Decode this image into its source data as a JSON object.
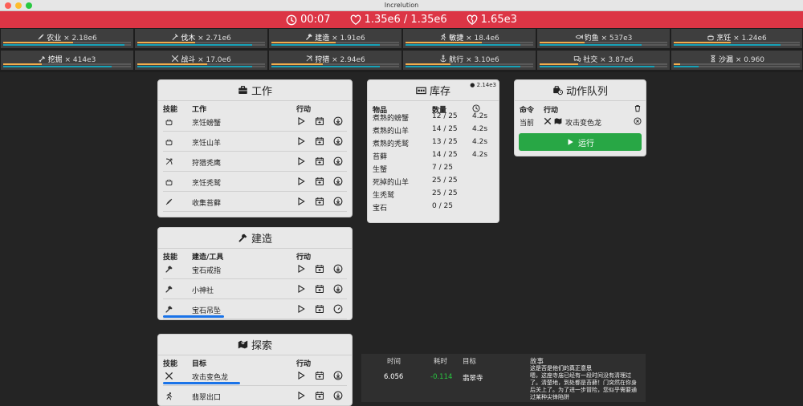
{
  "window": {
    "title": "Increlution"
  },
  "status": {
    "time": "00:07",
    "health": "1.35e6 / 1.35e6",
    "lifespan": "1.65e3"
  },
  "skills": [
    {
      "label": "农业",
      "mult": "× 2.18e6",
      "icon": "wheat-icon",
      "p1": 0.55,
      "p2": 0.95
    },
    {
      "label": "伐木",
      "mult": "× 2.71e6",
      "icon": "axe-icon",
      "p1": 0.45,
      "p2": 0.9
    },
    {
      "label": "建造",
      "mult": "× 1.91e6",
      "icon": "hammer-icon",
      "p1": 0.5,
      "p2": 0.85
    },
    {
      "label": "敏捷",
      "mult": "× 18.4e6",
      "icon": "runner-icon",
      "p1": 0.6,
      "p2": 0.9
    },
    {
      "label": "钓鱼",
      "mult": "× 537e3",
      "icon": "fish-icon",
      "p1": 0.35,
      "p2": 0.8
    },
    {
      "label": "烹饪",
      "mult": "× 1.24e6",
      "icon": "cooking-pot-icon",
      "p1": 0.45,
      "p2": 0.85
    },
    {
      "label": "挖掘",
      "mult": "× 414e3",
      "icon": "shovel-icon",
      "p1": 0.3,
      "p2": 0.85
    },
    {
      "label": "战斗",
      "mult": "× 17.0e6",
      "icon": "crossed-swords-icon",
      "p1": 0.55,
      "p2": 0.9
    },
    {
      "label": "狩猎",
      "mult": "× 2.94e6",
      "icon": "bow-icon",
      "p1": 0.4,
      "p2": 0.85
    },
    {
      "label": "航行",
      "mult": "× 3.10e6",
      "icon": "anchor-icon",
      "p1": 0.35,
      "p2": 0.9
    },
    {
      "label": "社交",
      "mult": "× 3.87e6",
      "icon": "chat-icon",
      "p1": 0.3,
      "p2": 0.9
    },
    {
      "label": "沙漏",
      "mult": "× 0.960",
      "icon": "hourglass-icon",
      "p1": 0.05,
      "p2": 0.2
    }
  ],
  "work": {
    "title": "工作",
    "col_skill": "技能",
    "col_name": "工作",
    "col_act": "行动",
    "rows": [
      {
        "name": "烹饪螃蟹",
        "icon": "cooking-pot-icon"
      },
      {
        "name": "烹饪山羊",
        "icon": "cooking-pot-icon"
      },
      {
        "name": "狩猎秃鹰",
        "icon": "bow-icon"
      },
      {
        "name": "烹饪秃鹫",
        "icon": "cooking-pot-icon"
      },
      {
        "name": "收集苔藓",
        "icon": "wheat-icon"
      }
    ]
  },
  "build": {
    "title": "建造",
    "col_skill": "技能",
    "col_name": "建造/工具",
    "col_act": "行动",
    "rows": [
      {
        "name": "宝石戒指",
        "icon": "hammer-icon"
      },
      {
        "name": "小神社",
        "icon": "hammer-icon"
      },
      {
        "name": "宝石吊坠",
        "icon": "hammer-icon",
        "progress": 0.33
      }
    ]
  },
  "explore": {
    "title": "探索",
    "col_skill": "技能",
    "col_name": "目标",
    "col_act": "行动",
    "rows": [
      {
        "name": "攻击变色龙",
        "icon": "crossed-swords-icon",
        "progress": 0.42
      },
      {
        "name": "翡翠出口",
        "icon": "runner-icon"
      }
    ]
  },
  "inventory": {
    "title": "库存",
    "capacity": "2.14e3",
    "col_item": "物品",
    "col_qty": "数量",
    "rows": [
      {
        "item": "煮熟的螃蟹",
        "qty": "12 / 25",
        "time": "4.2s"
      },
      {
        "item": "煮熟的山羊",
        "qty": "14 / 25",
        "time": "4.2s"
      },
      {
        "item": "煮熟的秃鹫",
        "qty": "13 / 25",
        "time": "4.2s"
      },
      {
        "item": "苔藓",
        "qty": "14 / 25",
        "time": "4.2s"
      },
      {
        "item": "生蟹",
        "qty": "7 / 25",
        "time": ""
      },
      {
        "item": "死掉的山羊",
        "qty": "25 / 25",
        "time": ""
      },
      {
        "item": "生秃鹫",
        "qty": "25 / 25",
        "time": ""
      },
      {
        "item": "宝石",
        "qty": "0 / 25",
        "time": ""
      }
    ]
  },
  "queue": {
    "title": "动作队列",
    "col_cmd": "命令",
    "col_act": "行动",
    "current_label": "当前",
    "current_action": "攻击变色龙",
    "run_label": "运行"
  },
  "log": {
    "col_time": "时间",
    "col_dur": "耗时",
    "col_target": "目标",
    "col_story": "故事",
    "top_story": "这是否是他们的真正意思",
    "entry": {
      "time": "6.056",
      "dur": "-0.114",
      "target": "翡翠寺",
      "story": "嗯，这座寺庙已经有一段时间没有清理过了。清楚地，到处都是苔藓！门突然在你身后关上了。为了进一步冒险，您似乎需要通过某种尖锋陷阱"
    }
  },
  "colors": {
    "status_red": "#dc3545",
    "run_green": "#28a745",
    "progress_blue": "#1a73e8",
    "bar_yellow": "#f0ad4e",
    "bar_teal": "#17a2b8"
  }
}
